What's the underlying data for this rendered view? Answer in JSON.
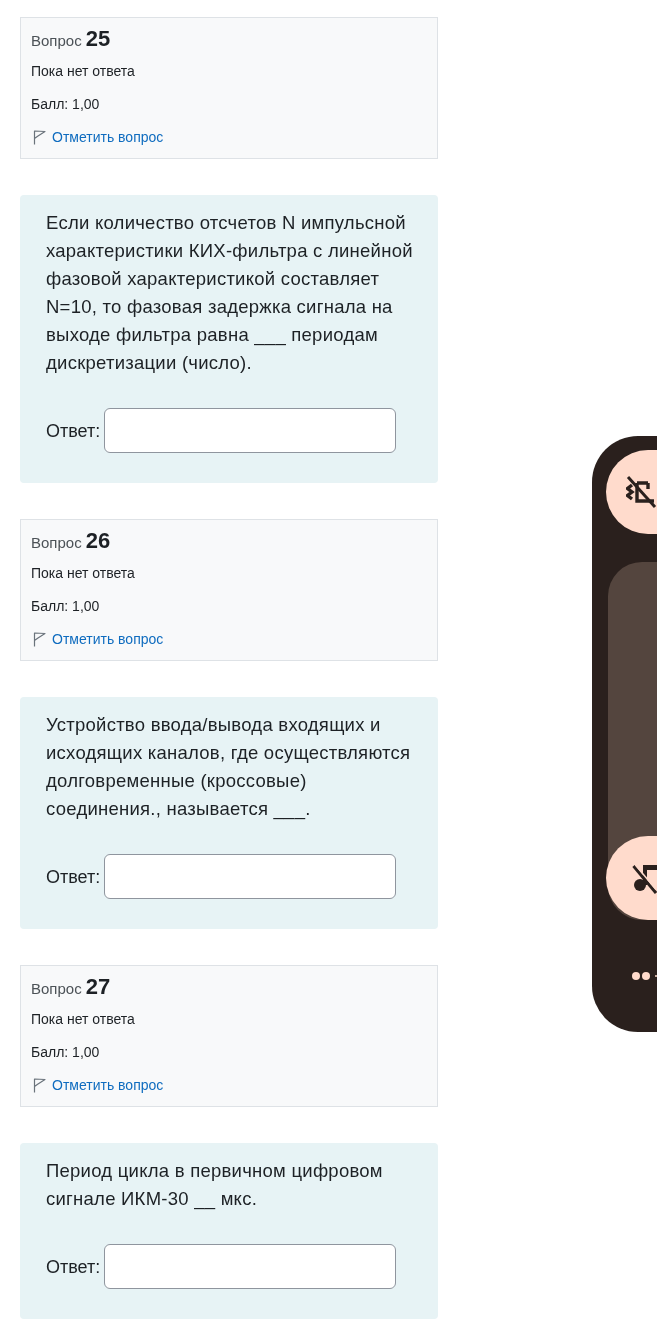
{
  "questions": [
    {
      "label": "Вопрос",
      "number": "25",
      "status": "Пока нет ответа",
      "grade": "Балл: 1,00",
      "flag_link": "Отметить вопрос",
      "text": "Если количество отсчетов N импульсной характеристики КИХ-фильтра с линейной фазовой характеристикой составляет N=10, то фазовая задержка сигнала на выходе фильтра равна ___ периодам дискретизации (число).",
      "answer_label": "Ответ:"
    },
    {
      "label": "Вопрос",
      "number": "26",
      "status": "Пока нет ответа",
      "grade": "Балл: 1,00",
      "flag_link": "Отметить вопрос",
      "text": "Устройство ввода/вывода входящих и исходящих каналов, где осуществляются долговременные (кроссовые) соединения., называется ___.",
      "answer_label": "Ответ:"
    },
    {
      "label": "Вопрос",
      "number": "27",
      "status": "Пока нет ответа",
      "grade": "Балл: 1,00",
      "flag_link": "Отметить вопрос",
      "text": "Период цикла в первичном цифровом сигнале ИКМ-30 __ мкс.",
      "answer_label": "Ответ:"
    }
  ],
  "volume_panel": {
    "level": 0
  }
}
